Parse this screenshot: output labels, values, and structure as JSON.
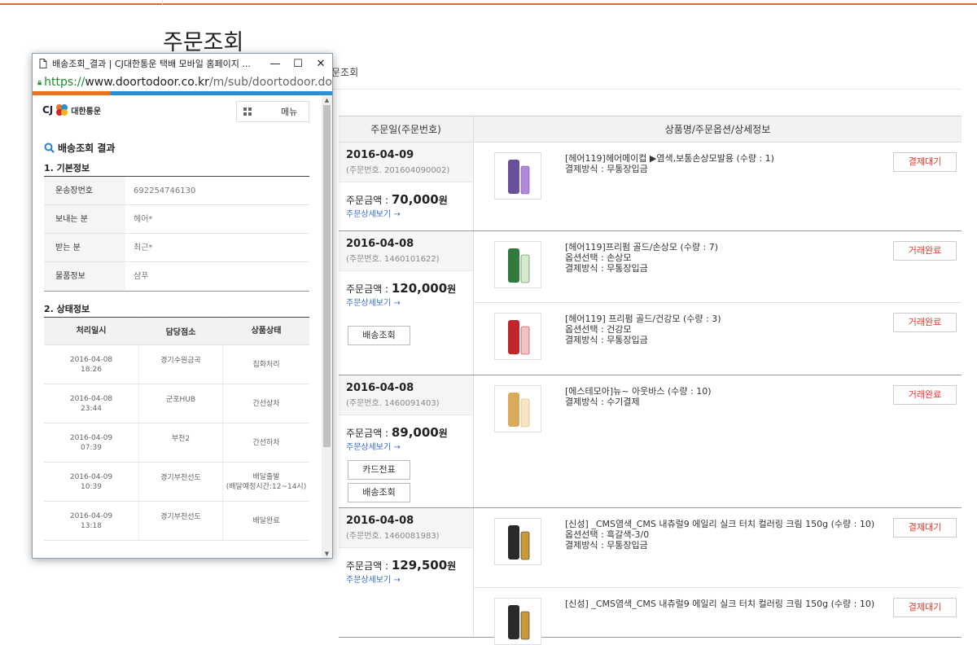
{
  "page": {
    "title": "주문조회",
    "breadcrumb": "문조회",
    "table_headers": [
      "주문일(주문번호)",
      "상품명/주문옵션/상세정보"
    ],
    "amount_label": "주문금액 : ",
    "detail_link": "주문상세보기 →",
    "won": "원"
  },
  "orders": [
    {
      "date": "2016-04-09",
      "order_no": "(주문번호. 201604090002)",
      "amount": "70,000",
      "buttons": [],
      "items": [
        {
          "name": "[헤어119]헤어메이컵 ▶염색,보통손상모발용 (수량 : 1)",
          "option": "",
          "payment": "결제방식 : 무통장입금",
          "status": "결제대기"
        }
      ]
    },
    {
      "date": "2016-04-08",
      "order_no": "(주문번호. 1460101622)",
      "amount": "120,000",
      "buttons": [
        "배송조회"
      ],
      "items": [
        {
          "name": "[헤어119]프리펌 골드/손상모 (수량 : 7)",
          "option": "옵션선택 : 손상모",
          "payment": "결제방식 : 무통장입금",
          "status": "거래완료"
        },
        {
          "name": "[헤어119] 프리펌 골드/건강모 (수량 : 3)",
          "option": "옵션선택 : 건강모",
          "payment": "결제방식 : 무통장입금",
          "status": "거래완료"
        }
      ]
    },
    {
      "date": "2016-04-08",
      "order_no": "(주문번호. 1460091403)",
      "amount": "89,000",
      "buttons": [
        "카드전표",
        "배송조회"
      ],
      "items": [
        {
          "name": "[에스테모아]뉴~ 아웃바스 (수량 : 10)",
          "option": "",
          "payment": "결제방식 : 수기결제",
          "status": "거래완료"
        }
      ]
    },
    {
      "date": "2016-04-08",
      "order_no": "(주문번호. 1460081983)",
      "amount": "129,500",
      "buttons": [],
      "items": [
        {
          "name": "[신성] _CMS염색_CMS 내츄럴9 에일리 실크 터치 컬러링 크림 150g (수량 : 10)",
          "option": "옵션선택 : 흑갈색-3/0",
          "payment": "결제방식 : 무통장입금",
          "status": "결제대기"
        },
        {
          "name": "[신성] _CMS염색_CMS 내츄럴9 에일리 실크 터치 컬러링 크림 150g (수량 : 10)",
          "option": "",
          "payment": "",
          "status": "결제대기"
        }
      ]
    }
  ],
  "popup": {
    "window_title": "배송조회_결과 | CJ대한통운 택배 모바일 홈페이지 ...",
    "minimize": "—",
    "maximize": "☐",
    "close": "✕",
    "url_scheme": "https://",
    "url_host": "www.doortodoor.co.kr",
    "url_path": "/m/sub/doortodoor.do",
    "logo_cj": "CJ",
    "logo_text": "대한통운",
    "menu_label": "메뉴",
    "result_title": "배송조회 결과",
    "basic_title": "1. 기본정보",
    "basic_info": [
      {
        "key": "운송장번호",
        "value": "692254746130"
      },
      {
        "key": "보내는 분",
        "value": "헤어*"
      },
      {
        "key": "받는 분",
        "value": "최근*"
      },
      {
        "key": "물품정보",
        "value": "샴푸"
      }
    ],
    "state_title": "2. 상태정보",
    "state_headers": [
      "처리일시",
      "담당점소",
      "상품상태"
    ],
    "state_rows": [
      {
        "date": "2016-04-08",
        "time": "18:26",
        "branch": "경기수원금곡",
        "status": "집화처리",
        "sub": ""
      },
      {
        "date": "2016-04-08",
        "time": "23:44",
        "branch": "군포HUB",
        "status": "간선상차",
        "sub": ""
      },
      {
        "date": "2016-04-09",
        "time": "07:39",
        "branch": "부천2",
        "status": "간선하차",
        "sub": ""
      },
      {
        "date": "2016-04-09",
        "time": "10:39",
        "branch": "경기부천선도",
        "status": "배달출발",
        "sub": "(배달예정시간:12~14시)"
      },
      {
        "date": "2016-04-09",
        "time": "13:18",
        "branch": "경기부천선도",
        "status": "배달완료",
        "sub": ""
      }
    ]
  }
}
